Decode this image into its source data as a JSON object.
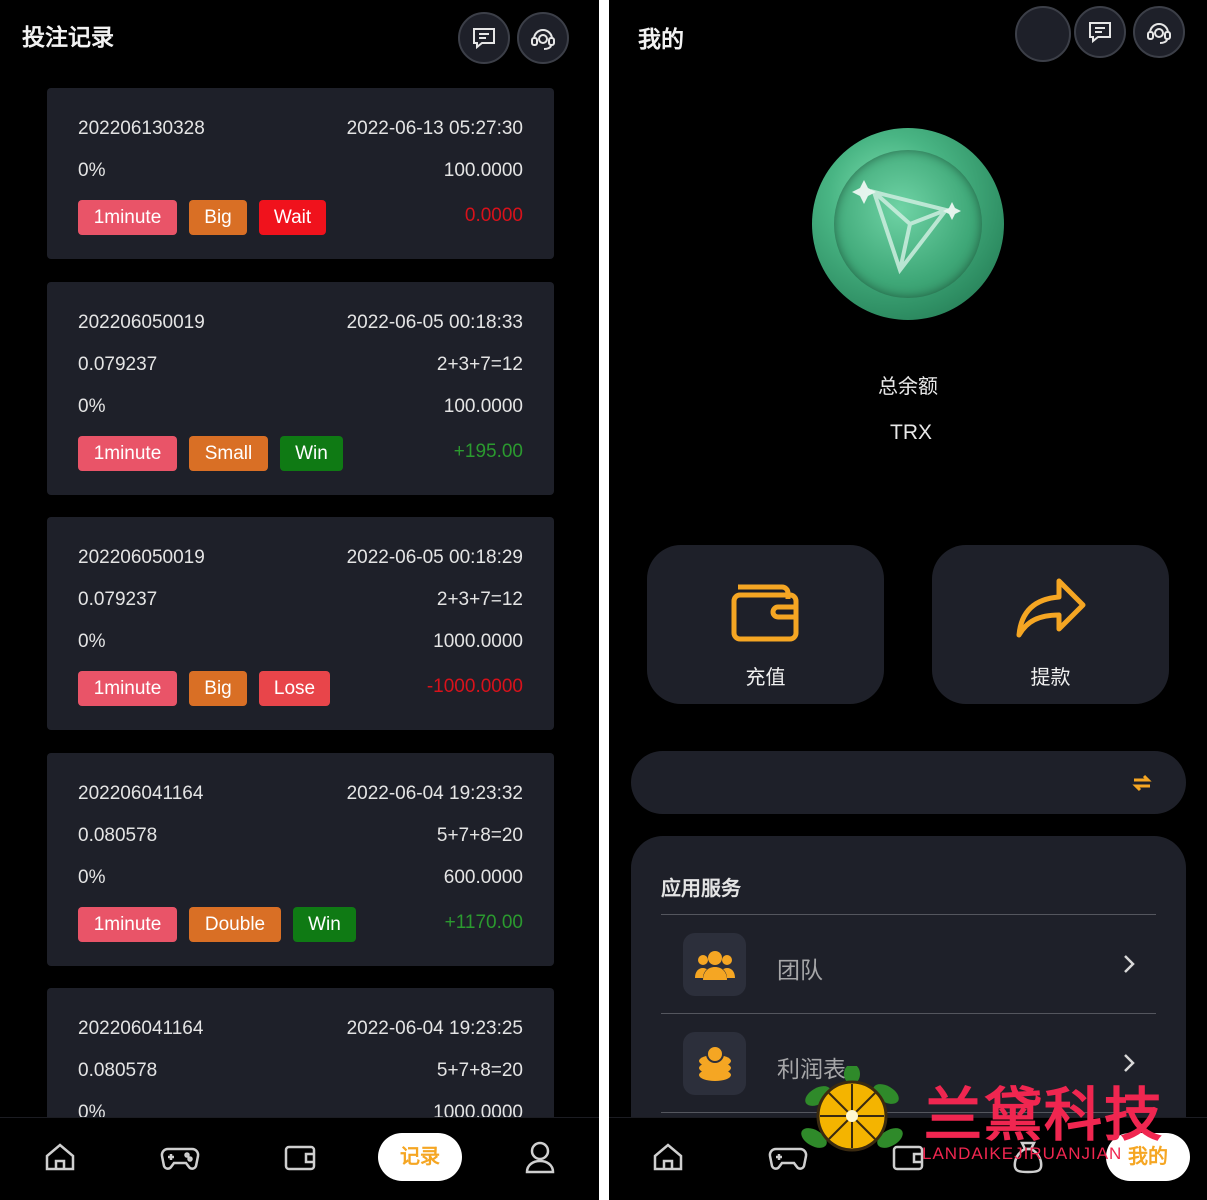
{
  "left": {
    "title": "投注记录",
    "records": [
      {
        "id": "202206130328",
        "time": "2022-06-13 05:27:30",
        "rows": [
          {
            "l": "0%",
            "r": "100.0000"
          }
        ],
        "tags": [
          {
            "label": "1minute",
            "kind": "pink",
            "w": 99
          },
          {
            "label": "Big",
            "kind": "orange",
            "w": 58
          },
          {
            "label": "Wait",
            "kind": "red",
            "w": 67
          }
        ],
        "amount": "0.0000",
        "amount_kind": "red"
      },
      {
        "id": "202206050019",
        "time": "2022-06-05 00:18:33",
        "rows": [
          {
            "l": "0.079237",
            "r": "2+3+7=12"
          },
          {
            "l": "0%",
            "r": "100.0000"
          }
        ],
        "tags": [
          {
            "label": "1minute",
            "kind": "pink",
            "w": 99
          },
          {
            "label": "Small",
            "kind": "orange",
            "w": 79
          },
          {
            "label": "Win",
            "kind": "green",
            "w": 63
          }
        ],
        "amount": "+195.00",
        "amount_kind": "green"
      },
      {
        "id": "202206050019",
        "time": "2022-06-05 00:18:29",
        "rows": [
          {
            "l": "0.079237",
            "r": "2+3+7=12"
          },
          {
            "l": "0%",
            "r": "1000.0000"
          }
        ],
        "tags": [
          {
            "label": "1minute",
            "kind": "pink",
            "w": 99
          },
          {
            "label": "Big",
            "kind": "orange",
            "w": 58
          },
          {
            "label": "Lose",
            "kind": "lose",
            "w": 71
          }
        ],
        "amount": "-1000.0000",
        "amount_kind": "red"
      },
      {
        "id": "202206041164",
        "time": "2022-06-04 19:23:32",
        "rows": [
          {
            "l": "0.080578",
            "r": "5+7+8=20"
          },
          {
            "l": "0%",
            "r": "600.0000"
          }
        ],
        "tags": [
          {
            "label": "1minute",
            "kind": "pink",
            "w": 99
          },
          {
            "label": "Double",
            "kind": "orange",
            "w": 92
          },
          {
            "label": "Win",
            "kind": "green",
            "w": 63
          }
        ],
        "amount": "+1170.00",
        "amount_kind": "green"
      },
      {
        "id": "202206041164",
        "time": "2022-06-04 19:23:25",
        "rows": [
          {
            "l": "0.080578",
            "r": "5+7+8=20"
          },
          {
            "l": "0%",
            "r": "1000.0000"
          }
        ],
        "tags": [],
        "amount": "",
        "amount_kind": "red"
      }
    ],
    "nav": {
      "active_label": "记录"
    }
  },
  "right": {
    "title": "我的",
    "balance_label": "总余额",
    "currency": "TRX",
    "recharge_label": "充值",
    "withdraw_label": "提款",
    "services_title": "应用服务",
    "services": [
      {
        "label": "团队",
        "icon": "team-icon"
      },
      {
        "label": "利润表",
        "icon": "coins-icon"
      }
    ],
    "nav": {
      "active_label": "我的"
    }
  },
  "watermark": {
    "title": "兰黛科技",
    "subtitle": "LANDAIKEJIRUANJIAN"
  },
  "colors": {
    "accent": "#f5a623",
    "card": "#1e2029",
    "win": "#0f7a14",
    "lose": "#e8454a"
  }
}
